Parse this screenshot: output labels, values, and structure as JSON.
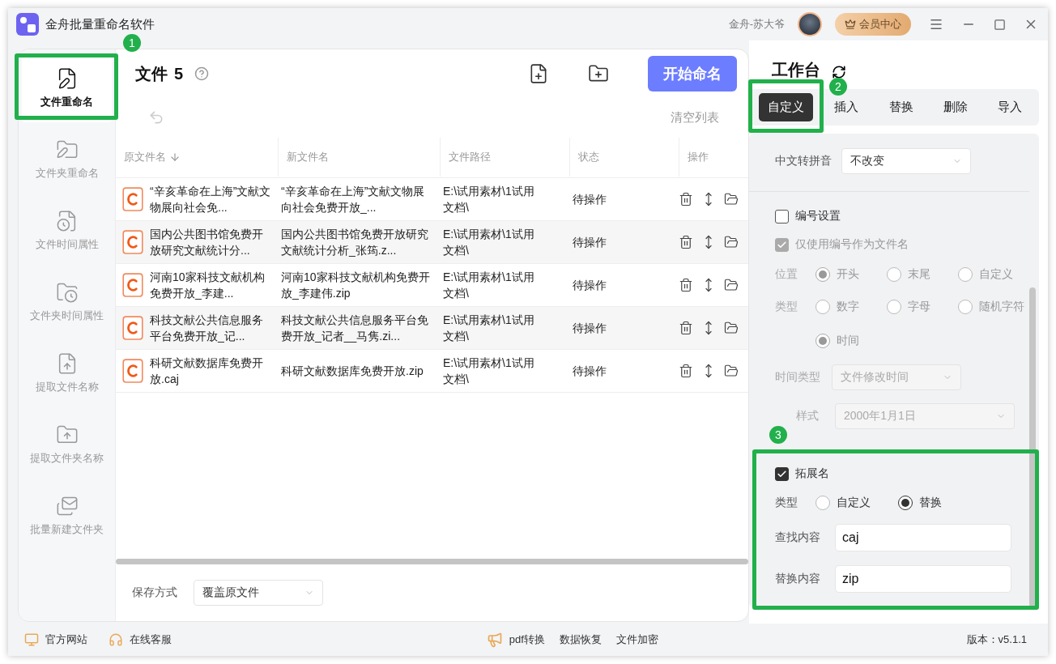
{
  "window": {
    "title": "金舟批量重命名软件"
  },
  "user": {
    "name": "金舟-苏大爷",
    "member_button": "会员中心"
  },
  "sidebar": {
    "items": [
      {
        "label": "文件重命名",
        "selected": true
      },
      {
        "label": "文件夹重命名",
        "selected": false
      },
      {
        "label": "文件时间属性",
        "selected": false
      },
      {
        "label": "文件夹时间属性",
        "selected": false
      },
      {
        "label": "提取文件名称",
        "selected": false
      },
      {
        "label": "提取文件夹名称",
        "selected": false
      },
      {
        "label": "批量新建文件夹",
        "selected": false
      }
    ]
  },
  "main": {
    "title": "文件",
    "count": "5",
    "start_button": "开始命名",
    "clear_button": "清空列表"
  },
  "table": {
    "columns": [
      "原文件名",
      "新文件名",
      "文件路径",
      "状态",
      "操作"
    ],
    "rows": [
      {
        "original": "“辛亥革命在上海”文献文物展向社会免...",
        "new": "“辛亥革命在上海”文献文物展向社会免费开放_...",
        "path": "E:\\试用素材\\1试用文档\\",
        "status": "待操作"
      },
      {
        "original": "国内公共图书馆免费开放研究文献统计分...",
        "new": "国内公共图书馆免费开放研究文献统计分析_张筠.z...",
        "path": "E:\\试用素材\\1试用文档\\",
        "status": "待操作"
      },
      {
        "original": "河南10家科技文献机构免费开放_李建...",
        "new": "河南10家科技文献机构免费开放_李建伟.zip",
        "path": "E:\\试用素材\\1试用文档\\",
        "status": "待操作"
      },
      {
        "original": "科技文献公共信息服务平台免费开放_记...",
        "new": "科技文献公共信息服务平台免费开放_记者__马隽.zi...",
        "path": "E:\\试用素材\\1试用文档\\",
        "status": "待操作"
      },
      {
        "original": "科研文献数据库免费开放.caj",
        "new": "科研文献数据库免费开放.zip",
        "path": "E:\\试用素材\\1试用文档\\",
        "status": "待操作"
      }
    ]
  },
  "save": {
    "label": "保存方式",
    "value": "覆盖原文件"
  },
  "workbench": {
    "title": "工作台",
    "tabs": [
      {
        "label": "自定义",
        "selected": true
      },
      {
        "label": "插入",
        "selected": false
      },
      {
        "label": "替换",
        "selected": false
      },
      {
        "label": "删除",
        "selected": false
      },
      {
        "label": "导入",
        "selected": false
      }
    ],
    "pinyin": {
      "label": "中文转拼音",
      "value": "不改变"
    },
    "numbering": {
      "label": "编号设置",
      "checked": false
    },
    "number_only": {
      "label": "仅使用编号作为文件名",
      "checked": true,
      "disabled": true
    },
    "position": {
      "label": "位置",
      "disabled": true,
      "options": [
        {
          "label": "开头",
          "selected": true
        },
        {
          "label": "末尾",
          "selected": false
        },
        {
          "label": "自定义",
          "selected": false
        }
      ]
    },
    "type": {
      "label": "类型",
      "disabled": true,
      "options": [
        {
          "label": "数字",
          "selected": false
        },
        {
          "label": "字母",
          "selected": false
        },
        {
          "label": "随机字符",
          "selected": false
        },
        {
          "label": "时间",
          "selected": true
        }
      ]
    },
    "time_type": {
      "label": "时间类型",
      "value": "文件修改时间",
      "disabled": true
    },
    "style": {
      "label": "样式",
      "value": "2000年1月1日",
      "disabled": true
    },
    "extension": {
      "label": "拓展名",
      "checked": true
    },
    "extension_type": {
      "label": "类型",
      "disabled": false,
      "options": [
        {
          "label": "自定义",
          "selected": false
        },
        {
          "label": "替换",
          "selected": true
        }
      ]
    },
    "find": {
      "label": "查找内容",
      "value": "caj"
    },
    "replace": {
      "label": "替换内容",
      "value": "zip"
    }
  },
  "annotations": [
    {
      "label": "1"
    },
    {
      "label": "2"
    },
    {
      "label": "3"
    }
  ],
  "footer": {
    "links": [
      "官方网站",
      "在线客服"
    ],
    "tools": [
      "pdf转换",
      "数据恢复",
      "文件加密"
    ],
    "version": "版本：v5.1.1"
  }
}
